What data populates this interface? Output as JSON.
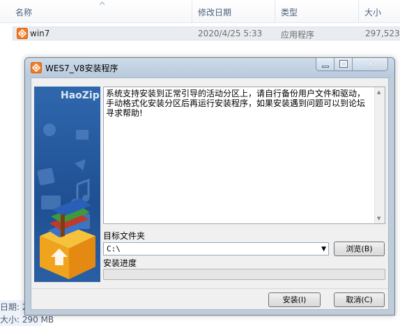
{
  "explorer": {
    "columns": {
      "name": "名称",
      "modified": "修改日期",
      "type": "类型",
      "size": "大小"
    },
    "file": {
      "name": "win7",
      "modified": "2020/4/25 5:33",
      "type": "应用程序",
      "size": "297,523"
    },
    "details": {
      "date_label": "日期: 2",
      "size_label": "大小: 290 MB"
    }
  },
  "installer": {
    "title": "WES7_V8安装程序",
    "brand": "HaoZip",
    "message": "系统支持安装到正常引导的活动分区上，请自行备份用户文件和驱动，手动格式化安装分区后再运行安装程序，如果安装遇到问题可以到论坛寻求帮助!",
    "target_folder_label": "目标文件夹",
    "target_folder_value": "C:\\",
    "browse_button": "浏览(B)",
    "progress_label": "安装进度",
    "progress_value": 0,
    "install_button": "安装(I)",
    "cancel_button": "取消(C)"
  },
  "colors": {
    "accent_orange": "#f47a20",
    "banner_blue": "#2a5fa3",
    "progress_green": "#06b025"
  },
  "icons": {
    "file": "haozip-app-icon",
    "title": "haozip-app-icon",
    "minimize": "minimize-icon",
    "maximize": "maximize-icon",
    "close": "close-icon"
  }
}
